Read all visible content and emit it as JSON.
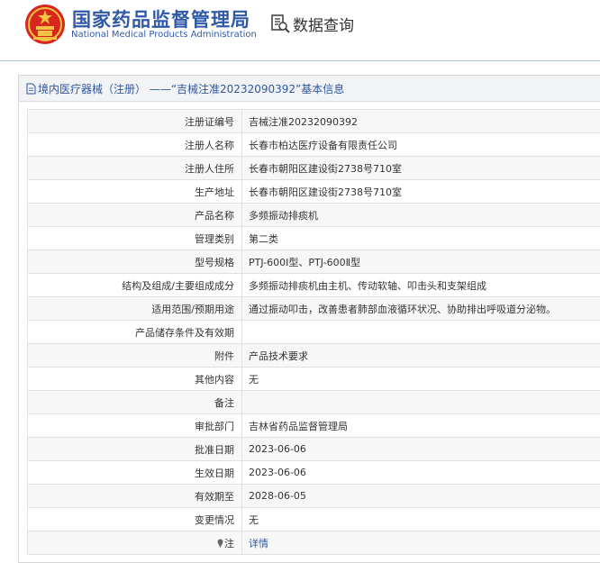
{
  "header": {
    "org_cn": "国家药品监督管理局",
    "org_en": "National Medical Products Administration",
    "db_query": "数据查询",
    "brand_color": "#2f59a8"
  },
  "panel": {
    "title": "境内医疗器械（注册） ——“吉械注准20232090392”基本信息"
  },
  "rows": [
    {
      "label": "注册证编号",
      "value": "吉械注准20232090392"
    },
    {
      "label": "注册人名称",
      "value": "长春市柏达医疗设备有限责任公司"
    },
    {
      "label": "注册人住所",
      "value": "长春市朝阳区建设街2738号710室"
    },
    {
      "label": "生产地址",
      "value": "长春市朝阳区建设街2738号710室"
    },
    {
      "label": "产品名称",
      "value": "多频振动排痰机"
    },
    {
      "label": "管理类别",
      "value": "第二类"
    },
    {
      "label": "型号规格",
      "value": "PTJ-600Ⅰ型、PTJ-600Ⅱ型"
    },
    {
      "label": "结构及组成/主要组成成分",
      "value": "多频振动排痰机由主机、传动软轴、叩击头和支架组成"
    },
    {
      "label": "适用范围/预期用途",
      "value": "通过振动叩击，改善患者肺部血液循环状况、协助排出呼吸道分泌物。"
    },
    {
      "label": "产品储存条件及有效期",
      "value": ""
    },
    {
      "label": "附件",
      "value": "产品技术要求"
    },
    {
      "label": "其他内容",
      "value": "无"
    },
    {
      "label": "备注",
      "value": ""
    },
    {
      "label": "审批部门",
      "value": "吉林省药品监督管理局"
    },
    {
      "label": "批准日期",
      "value": "2023-06-06"
    },
    {
      "label": "生效日期",
      "value": "2023-06-06"
    },
    {
      "label": "有效期至",
      "value": "2028-06-05"
    },
    {
      "label": "变更情况",
      "value": "无"
    }
  ],
  "note_row": {
    "label": "注",
    "icon": "pin-icon",
    "link_text": "详情"
  }
}
